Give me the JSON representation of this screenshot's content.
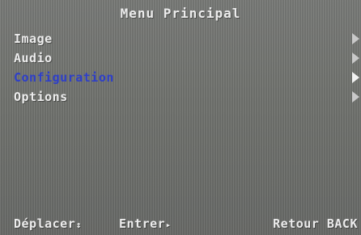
{
  "title": "Menu Principal",
  "menu": {
    "items": [
      {
        "label": "Image",
        "icon": "arrow-right-icon"
      },
      {
        "label": "Audio",
        "icon": "arrow-right-icon"
      },
      {
        "label": "Configuration",
        "icon": "arrow-right-icon",
        "selected": true
      },
      {
        "label": "Options",
        "icon": "arrow-right-icon"
      }
    ]
  },
  "footer": {
    "move_label": "Déplacer",
    "move_icon": "up-down-icon",
    "enter_label": "Entrer",
    "enter_icon": "enter-arrow-icon",
    "back_label": "Retour BACK"
  },
  "colors": {
    "text": "#ececec",
    "selected": "#2e3fc9",
    "background": "#727470"
  }
}
